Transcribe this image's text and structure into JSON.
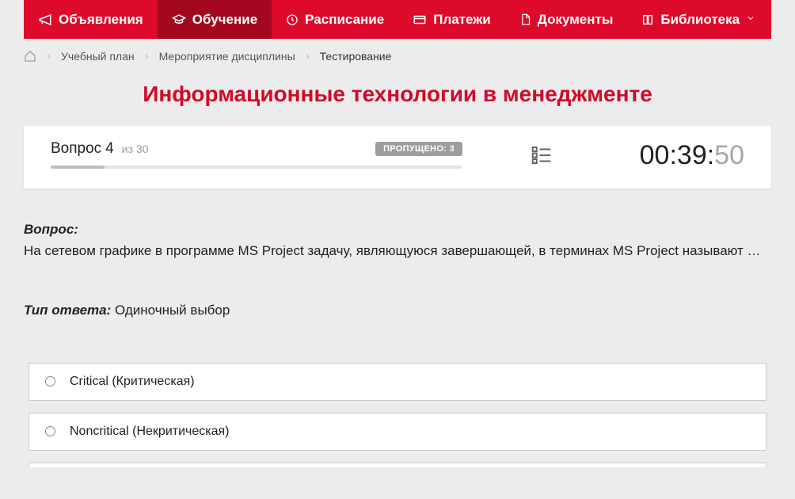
{
  "nav": {
    "items": [
      {
        "label": "Объявления",
        "icon": "megaphone"
      },
      {
        "label": "Обучение",
        "icon": "graduation-cap",
        "active": true
      },
      {
        "label": "Расписание",
        "icon": "clock"
      },
      {
        "label": "Платежи",
        "icon": "card"
      },
      {
        "label": "Документы",
        "icon": "doc"
      },
      {
        "label": "Библиотека",
        "icon": "book",
        "dropdown": true
      }
    ]
  },
  "breadcrumb": {
    "items": [
      {
        "label": "Учебный план"
      },
      {
        "label": "Мероприятие дисциплины"
      },
      {
        "label": "Тестирование",
        "current": true
      }
    ]
  },
  "page_title": "Информационные технологии в менеджменте",
  "quiz": {
    "question_word": "Вопрос",
    "question_num": "4",
    "question_of_word": "из",
    "question_total": "30",
    "skipped_label": "ПРОПУЩЕНО: 3",
    "progress_pct": 13,
    "timer_main": "00:39:",
    "timer_sec": "50"
  },
  "question": {
    "label": "Вопрос:",
    "text": "На сетевом графике в программе MS Project задачу, являющуюся завершающей, в терминах MS Project называют …",
    "answer_type_label": "Тип ответа:",
    "answer_type_value": " Одиночный выбор"
  },
  "answers": [
    {
      "text": "Critical (Критическая)"
    },
    {
      "text": "Noncritical (Некритическая)"
    }
  ]
}
